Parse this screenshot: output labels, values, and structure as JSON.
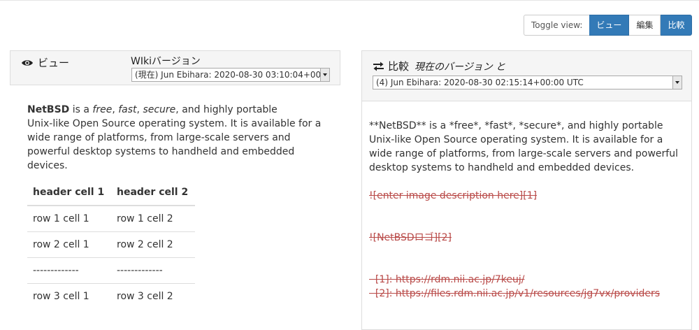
{
  "toggle": {
    "label": "Toggle view:",
    "buttons": [
      {
        "label": "ビュー",
        "active": true
      },
      {
        "label": "編集",
        "active": false
      },
      {
        "label": "比較",
        "active": true
      }
    ]
  },
  "left": {
    "title": "ビュー",
    "version_label": "WIkiバージョン",
    "version_selected": "(現在) Jun Ebihara: 2020-08-30 03:10:04+00:00 UTC",
    "paragraph": {
      "strong": "NetBSD",
      "t1": " is a ",
      "em1": "free",
      "t2": ", ",
      "em2": "fast",
      "t3": ", ",
      "em3": "secure",
      "t4": ", and highly portable",
      "line2": "Unix-like Open Source operating system. It is available for a",
      "line3": "wide range of platforms, from large-scale servers and",
      "line4": "powerful desktop systems to handheld and embedded",
      "line5": "devices."
    },
    "table": {
      "headers": [
        "header cell 1",
        "header cell 2"
      ],
      "rows": [
        [
          "row 1 cell 1",
          "row 1 cell 2"
        ],
        [
          "row 2 cell 1",
          "row 2 cell 2"
        ],
        [
          "-------------",
          "-------------"
        ],
        [
          "row 3 cell 1",
          "row 3 cell 2"
        ]
      ]
    }
  },
  "right": {
    "title": "比較",
    "subtitle": "現在のバージョン と",
    "version_selected": "(4) Jun Ebihara: 2020-08-30 02:15:14+00:00 UTC",
    "lines": [
      "**NetBSD** is a *free*, *fast*, *secure*, and highly portable",
      "Unix-like Open Source operating system. It is available for a",
      "wide range of platforms, from large-scale servers and powerful",
      "desktop systems to handheld and embedded devices."
    ],
    "deleted": [
      "![enter image description here][1]",
      "![NetBSDロゴ][2]",
      "  [1]: https://rdm.nii.ac.jp/7keuj/",
      "  [2]: https://files.rdm.nii.ac.jp/v1/resources/jg7vx/providers"
    ]
  },
  "colors": {
    "primary": "#337ab7",
    "deleted": "#b94a48",
    "panel_bg": "#f5f5f5"
  }
}
